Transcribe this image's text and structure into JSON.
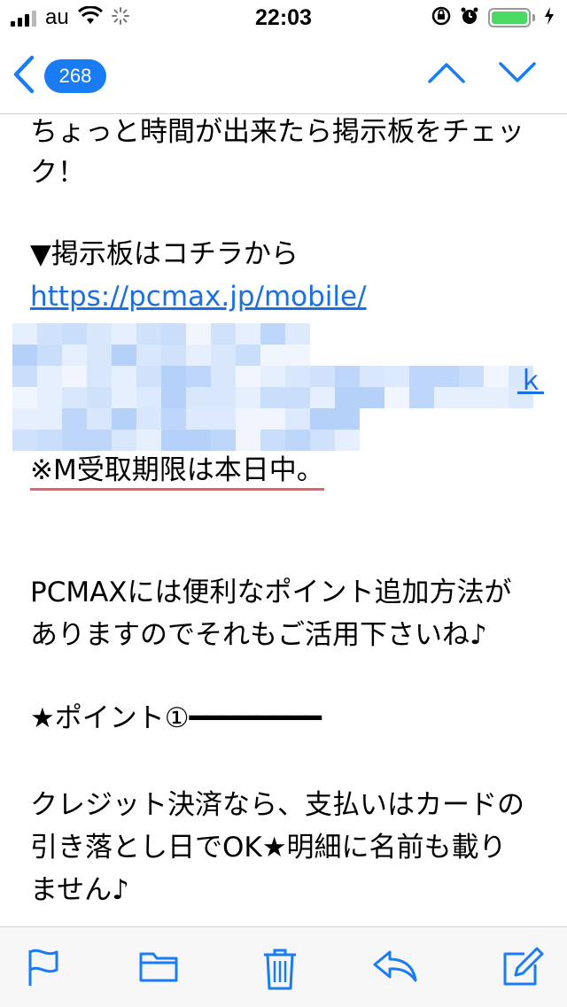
{
  "status_bar": {
    "carrier": "au",
    "time": "22:03",
    "battery_color": "#4cd964"
  },
  "nav": {
    "unread_count": "268",
    "accent_color": "#1a7cf5",
    "icons": [
      "back-chevron-icon",
      "chevron-up-icon",
      "chevron-down-icon"
    ]
  },
  "mail": {
    "lines": [
      "ちょっと時間が出来たら掲示板をチェッ",
      "ク！",
      "▼掲示板はコチラから",
      "※M受取期限は本日中。",
      "PCMAXには便利なポイント追加方法が",
      "ありますのでそれもご活用下さいね♪",
      "★ポイント①━━━━━━━━",
      "クレジット決済なら、支払いはカードの",
      "引き落とし日でOK★明細に名前も載り",
      "ません♪"
    ],
    "link_text": "https://pcmax.jp/mobile/",
    "link_fragment": "ｋ"
  },
  "toolbar": {
    "icons": [
      "flag-icon",
      "folder-icon",
      "trash-icon",
      "reply-icon",
      "compose-icon"
    ]
  }
}
